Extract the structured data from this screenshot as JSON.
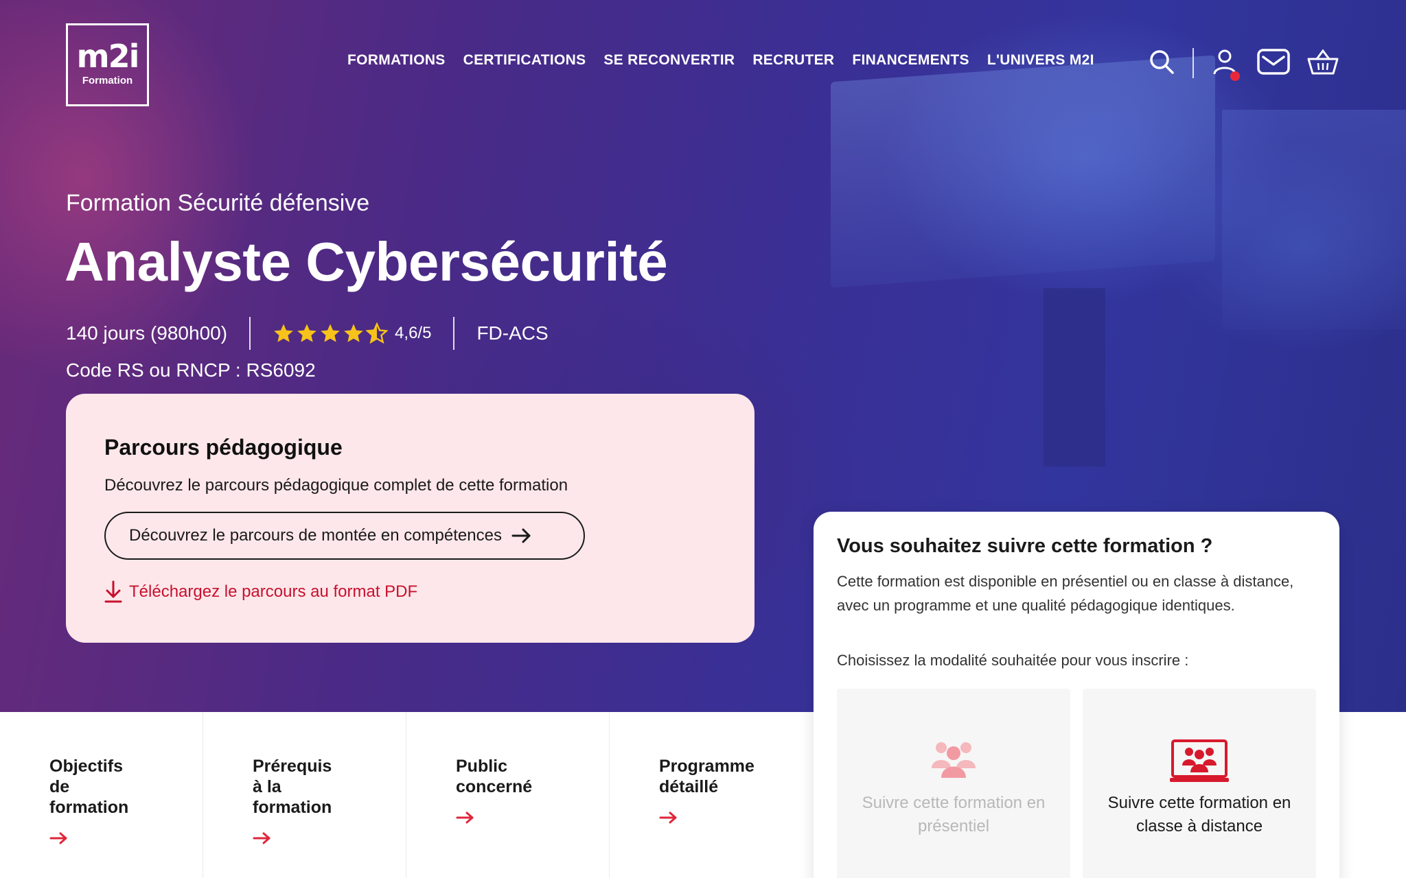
{
  "brand": {
    "logo_main": "m2i",
    "logo_sub": "Formation"
  },
  "nav": {
    "items": [
      "FORMATIONS",
      "CERTIFICATIONS",
      "SE RECONVERTIR",
      "RECRUTER",
      "FINANCEMENTS",
      "L'UNIVERS M2I"
    ]
  },
  "header_icons": [
    "search-icon",
    "user-icon",
    "mail-icon",
    "basket-icon"
  ],
  "hero": {
    "eyebrow": "Formation Sécurité défensive",
    "title": "Analyste Cybersécurité",
    "duration": "140 jours  (980h00)",
    "rating_value": 4.6,
    "rating_text": "4,6/5",
    "ref_code": "FD-ACS",
    "rncp": "Code RS ou RNCP : RS6092"
  },
  "parcours": {
    "title": "Parcours pédagogique",
    "description": "Découvrez le parcours pédagogique complet de cette formation",
    "button_label": "Découvrez le parcours de montée en compétences",
    "pdf_link": "Téléchargez le parcours au format PDF"
  },
  "tabs": [
    {
      "label": "Objectifs\nde\nformation"
    },
    {
      "label": "Prérequis\nà la\nformation"
    },
    {
      "label": "Public\nconcerné"
    },
    {
      "label": "Programme\ndétaillé"
    }
  ],
  "suivre": {
    "title": "Vous souhaitez suivre cette formation ?",
    "description": "Cette formation est disponible en présentiel ou en classe à distance, avec un programme et une qualité pédagogique identiques.",
    "choose": "Choisissez la modalité souhaitée pour vous inscrire :",
    "options": [
      {
        "label": "Suivre cette formation en présentiel",
        "state": "disabled"
      },
      {
        "label": "Suivre cette formation en classe à distance",
        "state": "enabled"
      }
    ]
  },
  "colors": {
    "accent_red": "#c8102e",
    "card_pink": "#fde7ea",
    "star_yellow": "#f7c31a"
  }
}
